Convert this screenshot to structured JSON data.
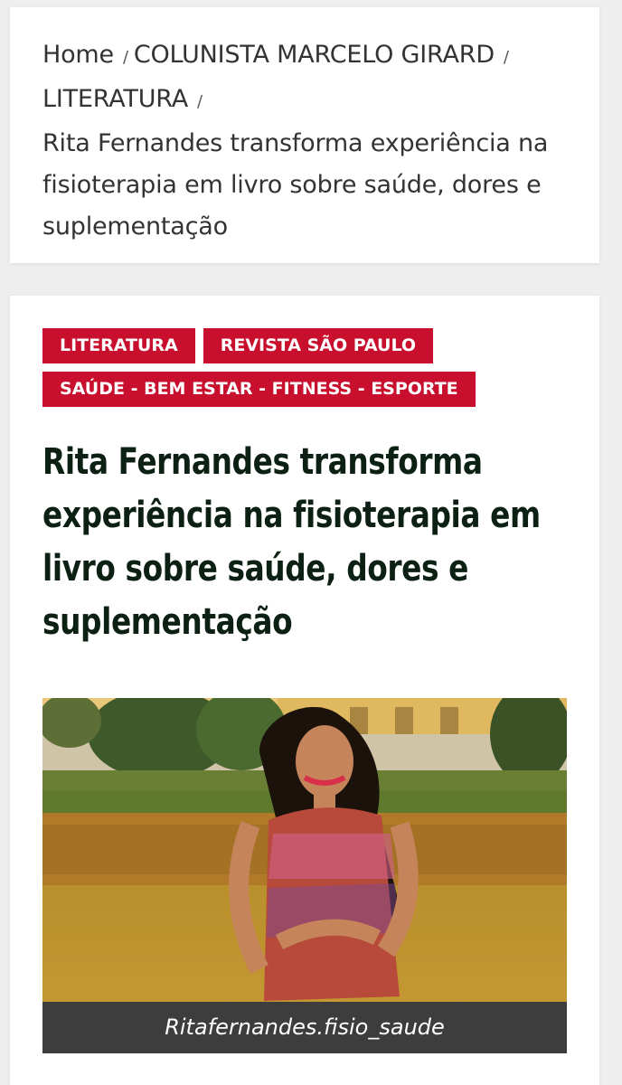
{
  "breadcrumb": {
    "items": [
      {
        "label": "Home"
      },
      {
        "label": "COLUNISTA MARCELO GIRARD"
      },
      {
        "label": "LITERATURA"
      }
    ],
    "current": "Rita Fernandes transforma experiência na fisioterapia em livro sobre saúde, dores e suplementação"
  },
  "article": {
    "tags": [
      {
        "label": "LITERATURA"
      },
      {
        "label": "REVISTA SÃO PAULO"
      },
      {
        "label": "SAÚDE - BEM ESTAR - FITNESS - ESPORTE"
      }
    ],
    "title": "Rita Fernandes transforma experiência na fisioterapia em livro sobre saúde, dores e suplementação",
    "image": {
      "caption": "Ritafernandes.fisio_saude"
    }
  },
  "colors": {
    "tag_bg": "#c8102e",
    "title": "#0d2014",
    "caption_bg": "#3d3d3d",
    "page_bg": "#eeeeee"
  }
}
